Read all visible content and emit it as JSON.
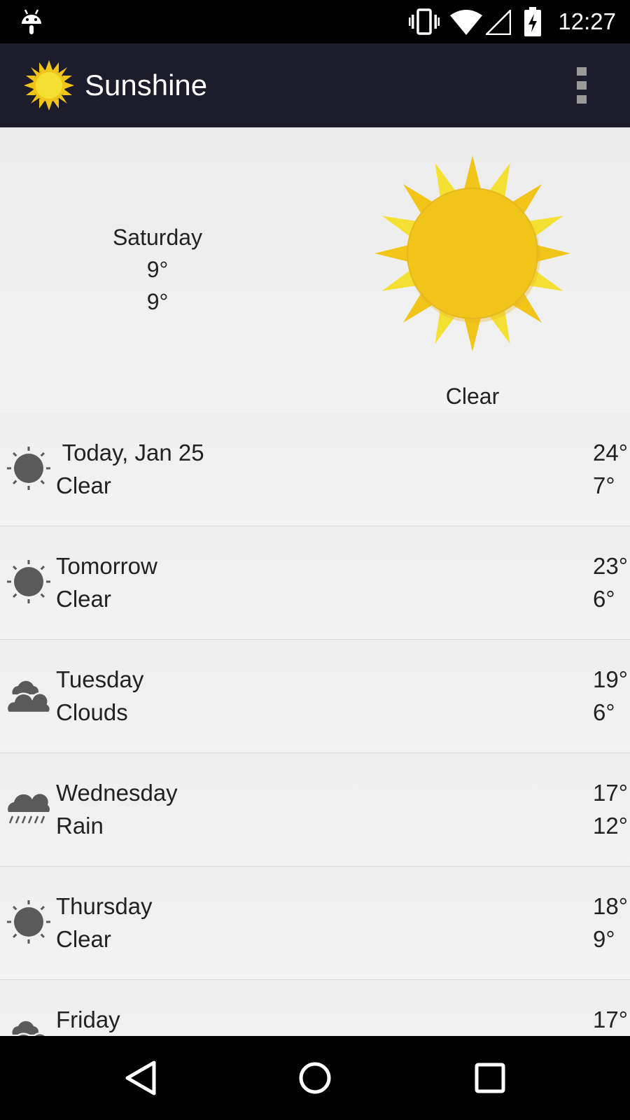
{
  "status_bar": {
    "time": "12:27",
    "icons": [
      "android-debug-icon",
      "vibrate-icon",
      "wifi-icon",
      "signal-icon",
      "battery-charging-icon"
    ]
  },
  "app_bar": {
    "title": "Sunshine",
    "logo_icon": "sun-icon",
    "menu_icon": "overflow-menu-icon"
  },
  "today": {
    "day": "Saturday",
    "high": "9°",
    "low": "9°",
    "condition": "Clear",
    "icon": "sun-icon"
  },
  "forecast": [
    {
      "day": " Today, Jan 25",
      "condition": "Clear",
      "high": "24°",
      "low": "7°",
      "icon": "clear"
    },
    {
      "day": "Tomorrow",
      "condition": "Clear",
      "high": "23°",
      "low": "6°",
      "icon": "clear"
    },
    {
      "day": "Tuesday",
      "condition": "Clouds",
      "high": "19°",
      "low": "6°",
      "icon": "clouds"
    },
    {
      "day": "Wednesday",
      "condition": "Rain",
      "high": "17°",
      "low": "12°",
      "icon": "rain"
    },
    {
      "day": "Thursday",
      "condition": "Clear",
      "high": "18°",
      "low": "9°",
      "icon": "clear"
    },
    {
      "day": "Friday",
      "condition": "",
      "high": "17°",
      "low": "",
      "icon": "clouds"
    }
  ],
  "nav_bar": {
    "buttons": [
      "back-icon",
      "home-icon",
      "recents-icon"
    ]
  },
  "colors": {
    "status_bar": "#000000",
    "app_bar": "#1c1c2a",
    "sun_yellow": "#f4e033",
    "sun_ray": "#f0c419",
    "list_icon": "#5a5a5a"
  }
}
